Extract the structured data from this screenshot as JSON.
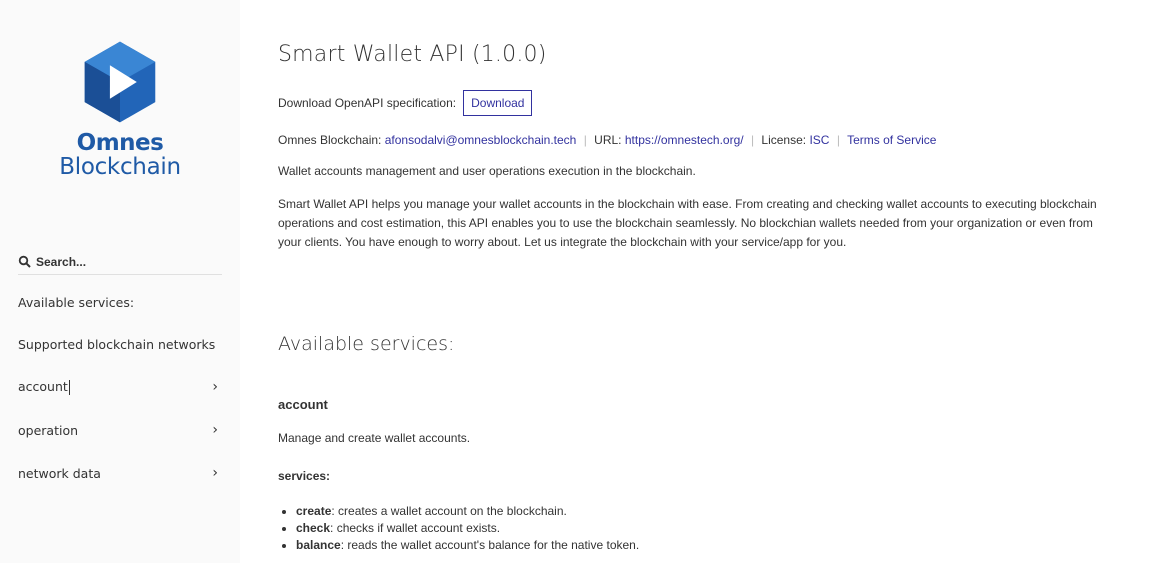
{
  "sidebar": {
    "logo": {
      "line1": "Omnes",
      "line2": "Blockchain"
    },
    "search": {
      "placeholder": "Search..."
    },
    "items": [
      {
        "label": "Available services:",
        "chevron": false
      },
      {
        "label": "Supported blockchain networks",
        "chevron": false
      },
      {
        "label": "account",
        "chevron": true
      },
      {
        "label": "operation",
        "chevron": true
      },
      {
        "label": "network data",
        "chevron": true
      }
    ]
  },
  "main": {
    "title": "Smart Wallet API (1.0.0)",
    "download": {
      "label": "Download OpenAPI specification:",
      "button": "Download"
    },
    "meta": {
      "contact_label": "Omnes Blockchain:",
      "email": "afonsodalvi@omnesblockchain.tech",
      "url_label": "URL:",
      "url": "https://omnestech.org/",
      "license_label": "License:",
      "license": "ISC",
      "terms": "Terms of Service"
    },
    "short_description": "Wallet accounts management and user operations execution in the blockchain.",
    "description": "Smart Wallet API helps you manage your wallet accounts in the blockchain with ease. From creating and checking wallet accounts to executing blockchain operations and cost estimation, this API enables you to use the blockchain seamlessly. No blockchian wallets needed from your organization or even from your clients. You have enough to worry about. Let us integrate the blockchain with your service/app for you.",
    "available_services_heading": "Available services:",
    "account": {
      "heading": "account",
      "description": "Manage and create wallet accounts.",
      "services_label": "services:",
      "services": [
        {
          "name": "create",
          "text": ": creates a wallet account on the blockchain."
        },
        {
          "name": "check",
          "text": ": checks if wallet account exists."
        },
        {
          "name": "balance",
          "text": ": reads the wallet account's balance for the native token."
        }
      ]
    }
  },
  "colors": {
    "brand": "#1f5aa6",
    "link": "#32329f",
    "sidebar_bg": "#fafafa"
  },
  "icons": [
    "logo-icon",
    "search-icon",
    "chevron-right-icon"
  ]
}
